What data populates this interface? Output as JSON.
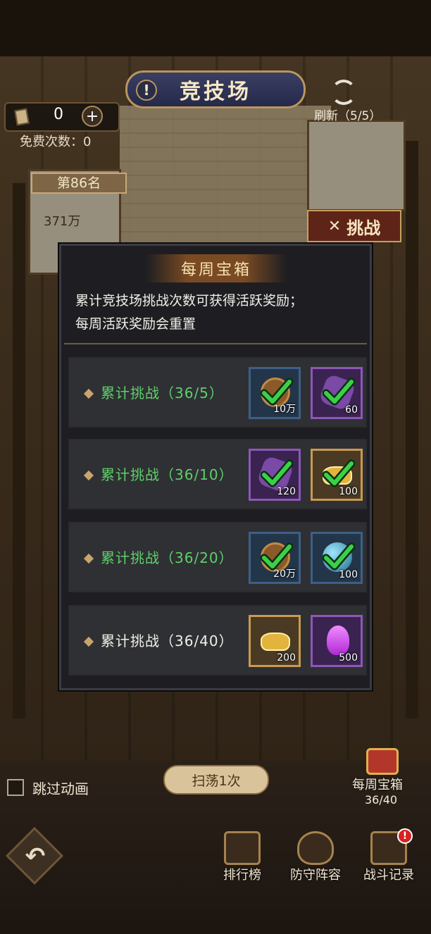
{
  "header": {
    "title": "竞技场",
    "alert_glyph": "!",
    "ticket_count": "0",
    "plus_glyph": "+",
    "free_attempts": "免费次数：0",
    "refresh": "刷新（5/5）"
  },
  "arena": {
    "rank": "第86名",
    "power": "371万",
    "challenge_label": "挑战"
  },
  "modal": {
    "title": "每周宝箱",
    "description_line1": "累计竞技场挑战次数可获得活跃奖励；",
    "description_line2": "每周活跃奖励会重置",
    "rows": [
      {
        "label": "累计挑战（36/5）",
        "claimed": true,
        "items": [
          {
            "icon": "copper-coin-icon",
            "qty": "10万",
            "rarity": "blue"
          },
          {
            "icon": "purple-fragment-icon",
            "qty": "60",
            "rarity": "purple"
          }
        ]
      },
      {
        "label": "累计挑战（36/10）",
        "claimed": true,
        "items": [
          {
            "icon": "purple-fragment-icon",
            "qty": "120",
            "rarity": "purple"
          },
          {
            "icon": "gold-ingot-icon",
            "qty": "100",
            "rarity": "gold"
          }
        ]
      },
      {
        "label": "累计挑战（36/20）",
        "claimed": true,
        "items": [
          {
            "icon": "copper-coin-icon",
            "qty": "20万",
            "rarity": "blue"
          },
          {
            "icon": "blue-orb-icon",
            "qty": "100",
            "rarity": "blue"
          }
        ]
      },
      {
        "label": "累计挑战（36/40）",
        "claimed": false,
        "items": [
          {
            "icon": "gold-ingot-icon",
            "qty": "200",
            "rarity": "gold"
          },
          {
            "icon": "purple-crystal-icon",
            "qty": "500",
            "rarity": "purple"
          }
        ]
      }
    ]
  },
  "bottom": {
    "skip_animation": "跳过动画",
    "sweep_button": "扫荡1次",
    "weekly_chest": "每周宝箱",
    "weekly_progress": "36/40",
    "nav": [
      {
        "label": "排行榜",
        "icon": "leaderboard-icon"
      },
      {
        "label": "防守阵容",
        "icon": "shield-icon"
      },
      {
        "label": "战斗记录",
        "icon": "battle-record-icon"
      }
    ],
    "battle_record_badge": "!"
  },
  "colors": {
    "claimed_label": "#5ed06a",
    "unclaimed_label": "#f2efe8",
    "check": "#3bd04a",
    "modal_bg": "#1e1e22",
    "row_bg": "#2f3034"
  }
}
